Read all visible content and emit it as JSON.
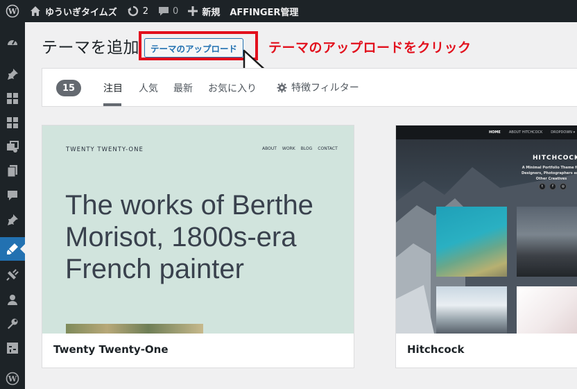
{
  "adminbar": {
    "site_name": "ゆういぎタイムズ",
    "updates_count": "2",
    "comments_count": "0",
    "new_label": "新規",
    "affinger_label": "AFFINGER管理"
  },
  "sidemenu": {
    "icons": [
      "dashboard-icon",
      "posts-icon",
      "blocks-icon",
      "blocks-icon-2",
      "media-icon",
      "pages-icon",
      "comments-icon",
      "pin-icon",
      "appearance-icon",
      "plugins-icon",
      "users-icon",
      "tools-icon",
      "settings-icon",
      "wordpress-icon"
    ],
    "current_index": 8
  },
  "page": {
    "title": "テーマを追加",
    "upload_button": "テーマのアップロード",
    "annotation": "テーマのアップロードをクリック",
    "annotation_color": "#e2101d"
  },
  "filters": {
    "count": "15",
    "tabs": [
      "注目",
      "人気",
      "最新",
      "お気に入り"
    ],
    "active_tab": "注目",
    "feature_filter": "特徴フィルター"
  },
  "themes": [
    {
      "name": "Twenty Twenty-One",
      "preview": {
        "site_title": "TWENTY TWENTY-ONE",
        "nav": [
          "ABOUT",
          "WORK",
          "BLOG",
          "CONTACT"
        ],
        "headline": "The works of Berthe Morisot, 1800s-era French painter"
      }
    },
    {
      "name": "Hitchcock",
      "preview": {
        "nav": [
          "HOME",
          "ABOUT HITCHCOCK",
          "DROPDOWN ▾"
        ],
        "site_title": "HITCHCOCK",
        "tagline": "A Minimal Portfolio Theme for Designers, Photographers and Other Creatives",
        "social": [
          "twitter-icon",
          "facebook-icon",
          "instagram-icon"
        ]
      }
    }
  ],
  "colors": {
    "admin_dark": "#1d2327",
    "accent_blue": "#2271b1",
    "highlight_red": "#e2101d",
    "tt1_bg": "#d1e4dd"
  }
}
